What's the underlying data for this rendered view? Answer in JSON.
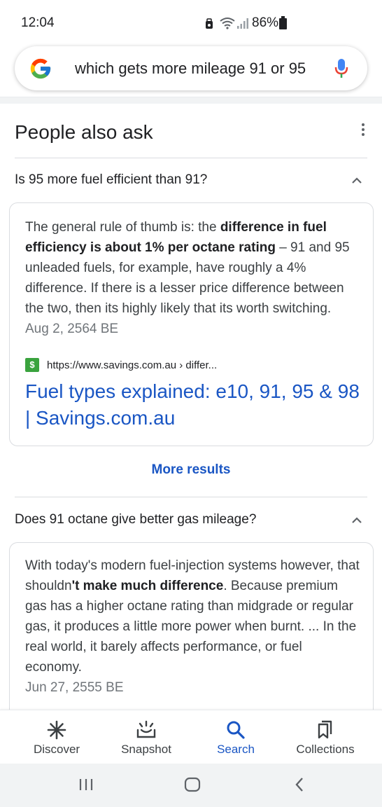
{
  "status_bar": {
    "time": "12:04",
    "battery": "86%"
  },
  "search": {
    "query": "which gets more mileage 91 or 95"
  },
  "paa": {
    "title": "People also ask",
    "items": [
      {
        "question": "Is 95 more fuel efficient than 91?",
        "answer_pre": "The general rule of thumb is: the ",
        "answer_bold": "difference in fuel efficiency is about 1% per octane rating",
        "answer_post": " – 91 and 95 unleaded fuels, for example, have roughly a 4% difference. If there is a lesser price difference between the two, then its highly likely that its worth switching.",
        "date": "Aug 2, 2564 BE",
        "source_url": "https://www.savings.com.au › differ...",
        "result_title": "Fuel types explained: e10, 91, 95 & 98 | Savings.com.au"
      },
      {
        "question": "Does 91 octane give better gas mileage?",
        "answer_pre": "With today's modern fuel-injection systems however, that shouldn",
        "answer_bold": "'t make much difference",
        "answer_post": ". Because premium gas has a higher octane rating than midgrade or regular gas, it produces a little more power when burnt. ... In the real world, it barely affects performance, or fuel economy.",
        "date": "Jun 27, 2555 BE"
      }
    ],
    "more_results": "More results"
  },
  "bottom_nav": {
    "items": [
      {
        "label": "Discover",
        "icon": "asterisk-icon"
      },
      {
        "label": "Snapshot",
        "icon": "snapshot-icon"
      },
      {
        "label": "Search",
        "icon": "search-icon"
      },
      {
        "label": "Collections",
        "icon": "collections-icon"
      }
    ],
    "active": "Search"
  },
  "colors": {
    "link": "#1a56c4",
    "text": "#202124",
    "secondary": "#70757a"
  }
}
